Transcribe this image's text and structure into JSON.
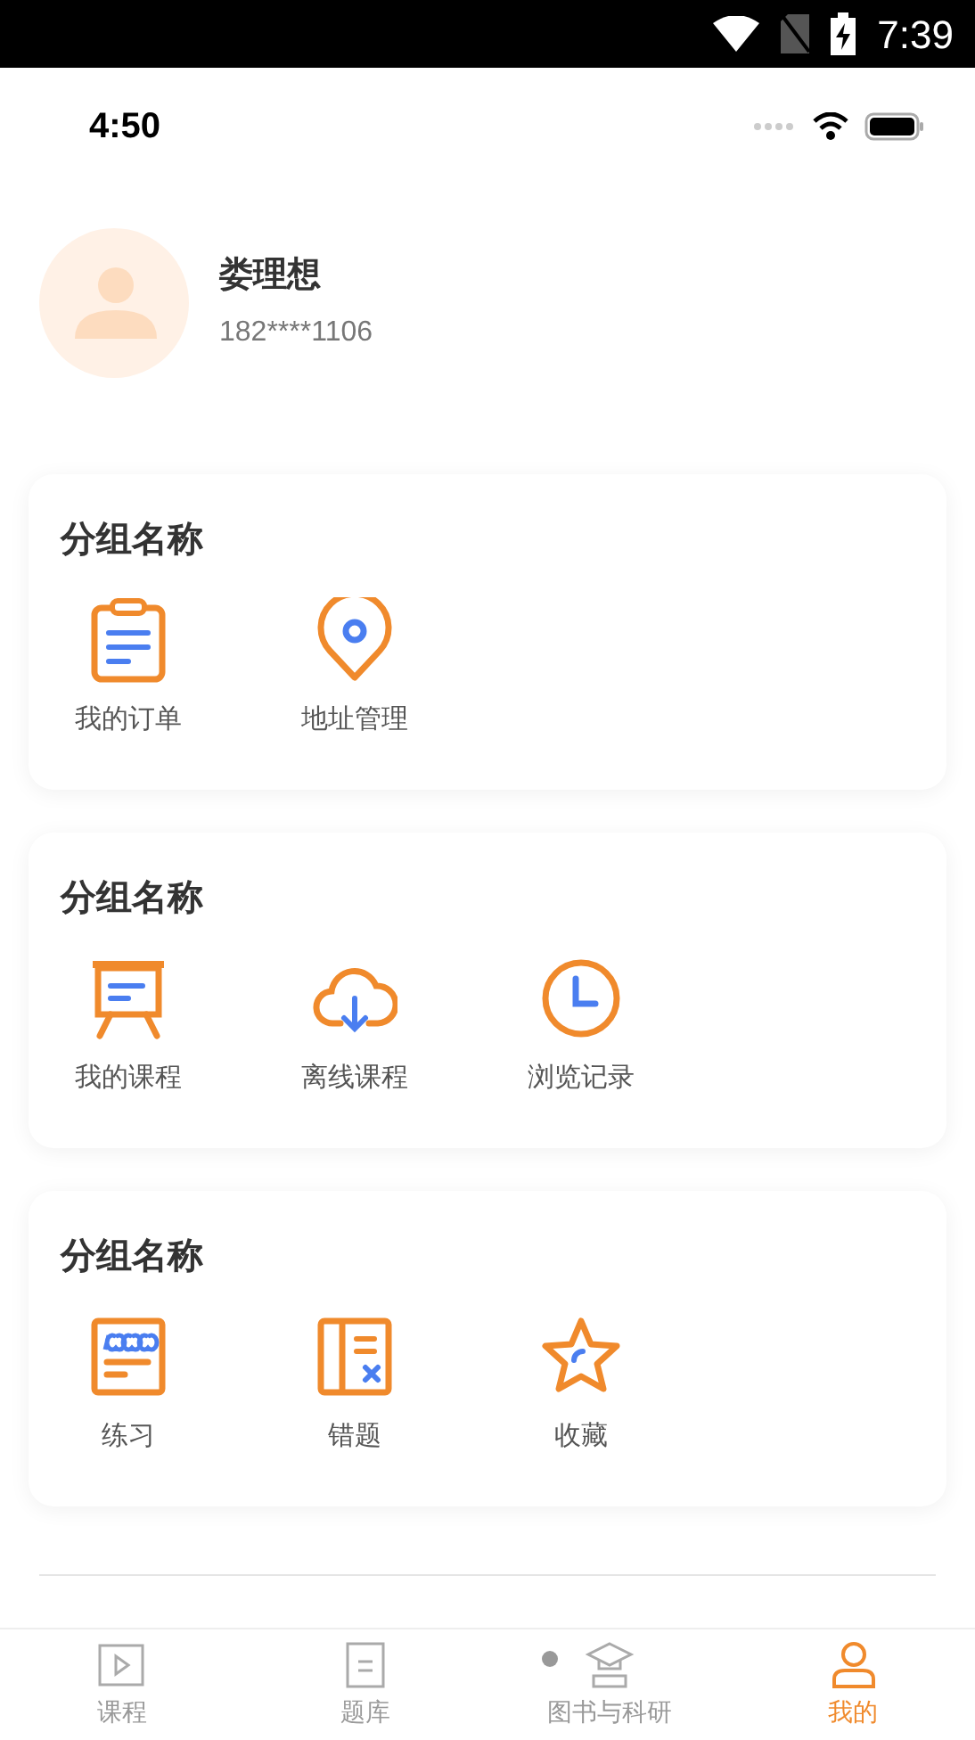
{
  "system_status_bar": {
    "time": "7:39"
  },
  "app_status_bar": {
    "time": "4:50"
  },
  "profile": {
    "name": "娄理想",
    "phone": "182****1106"
  },
  "groups": [
    {
      "title": "分组名称",
      "items": [
        {
          "label": "我的订单",
          "kind": "clipboard"
        },
        {
          "label": "地址管理",
          "kind": "pin"
        }
      ]
    },
    {
      "title": "分组名称",
      "items": [
        {
          "label": "我的课程",
          "kind": "board"
        },
        {
          "label": "离线课程",
          "kind": "cloud"
        },
        {
          "label": "浏览记录",
          "kind": "clock"
        }
      ]
    },
    {
      "title": "分组名称",
      "items": [
        {
          "label": "练习",
          "kind": "score"
        },
        {
          "label": "错题",
          "kind": "mistakes"
        },
        {
          "label": "收藏",
          "kind": "star"
        }
      ]
    }
  ],
  "tabs": [
    {
      "label": "课程",
      "kind": "play",
      "selected": false,
      "dot": false
    },
    {
      "label": "题库",
      "kind": "doc",
      "selected": false,
      "dot": false
    },
    {
      "label": "图书与科研",
      "kind": "cap",
      "selected": false,
      "dot": true
    },
    {
      "label": "我的",
      "kind": "person",
      "selected": true,
      "dot": false
    }
  ]
}
